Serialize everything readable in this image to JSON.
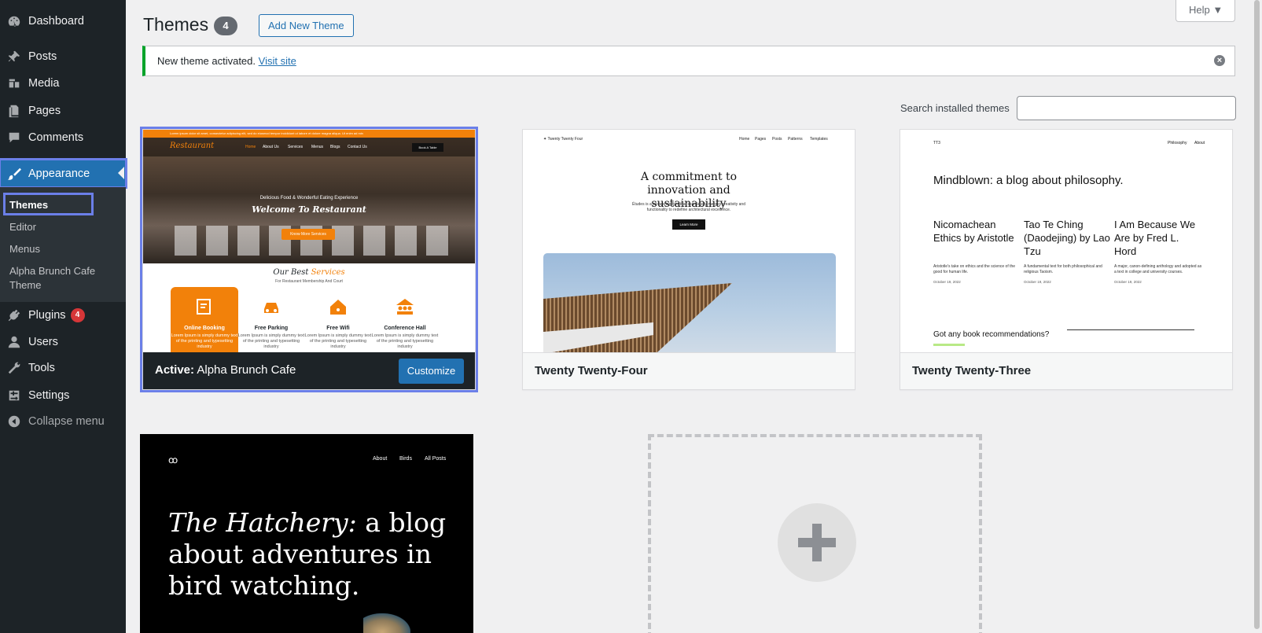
{
  "sidebar": {
    "items": [
      {
        "label": "Dashboard",
        "icon": "dashboard-icon"
      },
      {
        "label": "Posts",
        "icon": "pushpin-icon"
      },
      {
        "label": "Media",
        "icon": "media-icon"
      },
      {
        "label": "Pages",
        "icon": "pages-icon"
      },
      {
        "label": "Comments",
        "icon": "comments-icon"
      },
      {
        "label": "Appearance",
        "icon": "paintbrush-icon"
      },
      {
        "label": "Plugins",
        "icon": "plugin-icon",
        "badge": "4"
      },
      {
        "label": "Users",
        "icon": "users-icon"
      },
      {
        "label": "Tools",
        "icon": "wrench-icon"
      },
      {
        "label": "Settings",
        "icon": "settings-icon"
      },
      {
        "label": "Collapse menu",
        "icon": "collapse-icon"
      }
    ],
    "submenu": [
      "Themes",
      "Editor",
      "Menus",
      "Alpha Brunch Cafe Theme"
    ]
  },
  "header": {
    "title": "Themes",
    "count": "4",
    "add_new": "Add New Theme",
    "help": "Help ▼"
  },
  "notice": {
    "text": "New theme activated.",
    "link": "Visit site"
  },
  "search": {
    "label": "Search installed themes",
    "placeholder": ""
  },
  "themes": {
    "active": {
      "prefix": "Active:",
      "name": "Alpha Brunch Cafe",
      "customize": "Customize",
      "preview": {
        "topbar": "Lorem ipsum dolor sit amet, consectetur adipiscing elit, sed do eiusmod tempor incididunt ut labore et dolore magna aliqua. Ut enim ad min",
        "logo": "Restaurant",
        "nav": [
          "Home",
          "About Us",
          "Services",
          "Menus",
          "Blogs",
          "Contact Us"
        ],
        "book": "Book A Table",
        "pretitle": "Delicious Food & Wonderful Eating Experience",
        "title": "Welcome To Restaurant",
        "button": "Know More Services",
        "services_a": "Our Best",
        "services_b": "Services",
        "services_sub": "For Restaurant Membership And Court",
        "cards": [
          {
            "title": "Online Booking",
            "desc": "Lorem Ipsum is simply dummy text of the printing and typesetting industry"
          },
          {
            "title": "Free Parking",
            "desc": "Lorem Ipsum is simply dummy text of the printing and typesetting industry"
          },
          {
            "title": "Free Wifi",
            "desc": "Lorem Ipsum is simply dummy text of the printing and typesetting industry"
          },
          {
            "title": "Conference Hall",
            "desc": "Lorem Ipsum is simply dummy text of the printing and typesetting industry"
          }
        ]
      }
    },
    "tt4": {
      "name": "Twenty Twenty-Four",
      "preview": {
        "site": "Twenty Twenty Four",
        "nav": [
          "Home",
          "Pages",
          "Posts",
          "Patterns",
          "Templates"
        ],
        "heading": "A commitment to innovation and sustainability",
        "text": "Études is a pioneering firm that seamlessly merges creativity and functionality to redefine architectural excellence.",
        "button": "Learn More"
      }
    },
    "tt3": {
      "name": "Twenty Twenty-Three",
      "preview": {
        "site": "TT3",
        "nav": [
          "Philosophy",
          "About"
        ],
        "heading": "Mindblown: a blog about philosophy.",
        "posts": [
          {
            "title": "Nicomachean Ethics by Aristotle",
            "excerpt": "Aristotle's take on ethics and the science of the good for human life.",
            "date": "October 19, 2022"
          },
          {
            "title": "Tao Te Ching (Daodejing) by Lao Tzu",
            "excerpt": "A fundamental text for both philosophical and religious Taoism.",
            "date": "October 19, 2022"
          },
          {
            "title": "I Am Because We Are by Fred L. Hord",
            "excerpt": "A major, canon-defining anthology and adopted as a text in college and university courses.",
            "date": "October 19, 2022"
          }
        ],
        "question": "Got any book recommendations?"
      }
    },
    "hatchery": {
      "preview": {
        "logo": "ꝏ",
        "nav": [
          "About",
          "Birds",
          "All Posts"
        ],
        "title_italic": "The Hatchery:",
        "title_rest": " a blog about adventures in bird watching."
      }
    }
  },
  "colors": {
    "sidebar_bg": "#1d2327",
    "accent": "#2271b1",
    "highlight_outline": "#6b7fe8",
    "notice_success": "#00a32a",
    "restaurant_orange": "#f2810a",
    "badge_red": "#d63638"
  }
}
